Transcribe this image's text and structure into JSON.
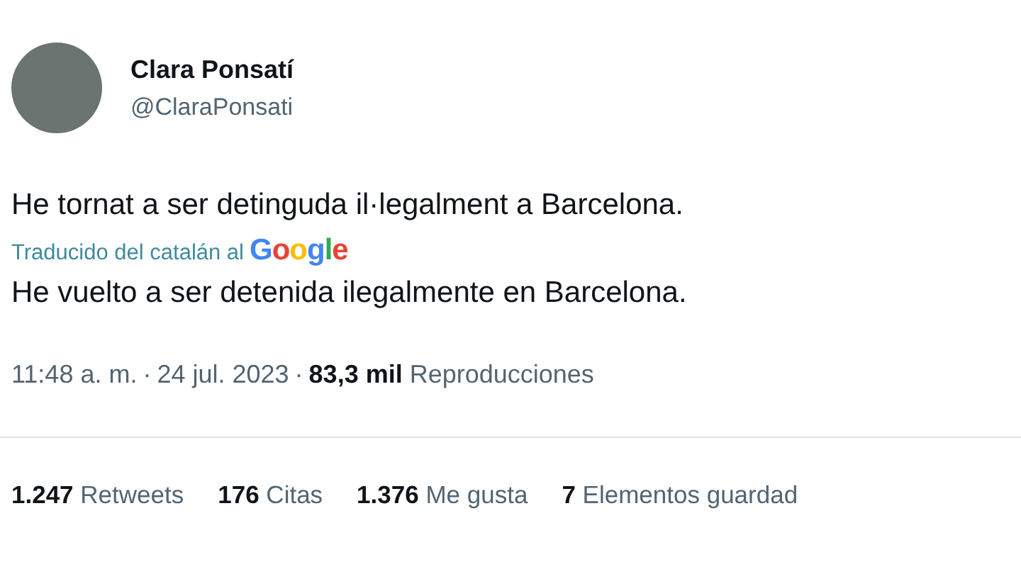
{
  "author": {
    "name": "Clara Ponsatí",
    "handle": "@ClaraPonsati"
  },
  "tweet_text": "He tornat a ser detinguda il·legalment a Barcelona.",
  "translation": {
    "label": "Traducido del catalán al",
    "provider": "Google",
    "text": "He vuelto a ser detenida ilegalmente en Barcelona."
  },
  "meta": {
    "time": "11:48 a. m.",
    "separator": "·",
    "date": "24 jul. 2023",
    "separator_2": "·",
    "views_count": "83,3 mil",
    "views_label": "Reproducciones"
  },
  "stats": [
    {
      "count": "1.247",
      "label": "Retweets"
    },
    {
      "count": "176",
      "label": "Citas"
    },
    {
      "count": "1.376",
      "label": "Me gusta"
    },
    {
      "count": "7",
      "label": "Elementos guardad"
    }
  ]
}
